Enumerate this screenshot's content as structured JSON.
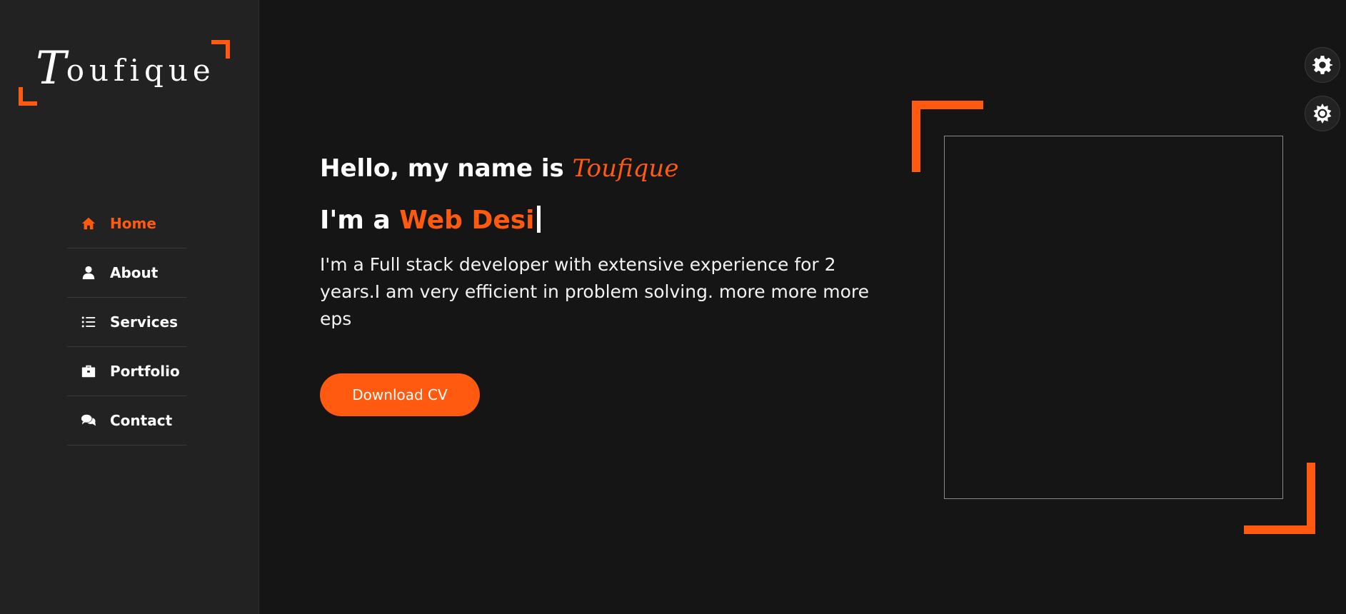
{
  "colors": {
    "accent": "#ff5a10",
    "background": "#151515",
    "sidebar": "#222222",
    "text": "#ffffff"
  },
  "logo": {
    "initial": "T",
    "rest": "oufique"
  },
  "nav": {
    "items": [
      {
        "label": "Home",
        "icon": "home-icon",
        "active": true
      },
      {
        "label": "About",
        "icon": "user-icon",
        "active": false
      },
      {
        "label": "Services",
        "icon": "list-icon",
        "active": false
      },
      {
        "label": "Portfolio",
        "icon": "briefcase-icon",
        "active": false
      },
      {
        "label": "Contact",
        "icon": "comments-icon",
        "active": false
      }
    ]
  },
  "hero": {
    "greeting_prefix": "Hello, my name is ",
    "greeting_name": "Toufique",
    "role_prefix": "I'm a ",
    "role_typed": "Web Desi",
    "bio": "I'm a Full stack developer with extensive experience for 2 years.I am very efficient in problem solving. more more more eps",
    "cv_button": "Download CV"
  },
  "floating": [
    {
      "icon": "gear-icon"
    },
    {
      "icon": "sun-icon"
    }
  ]
}
